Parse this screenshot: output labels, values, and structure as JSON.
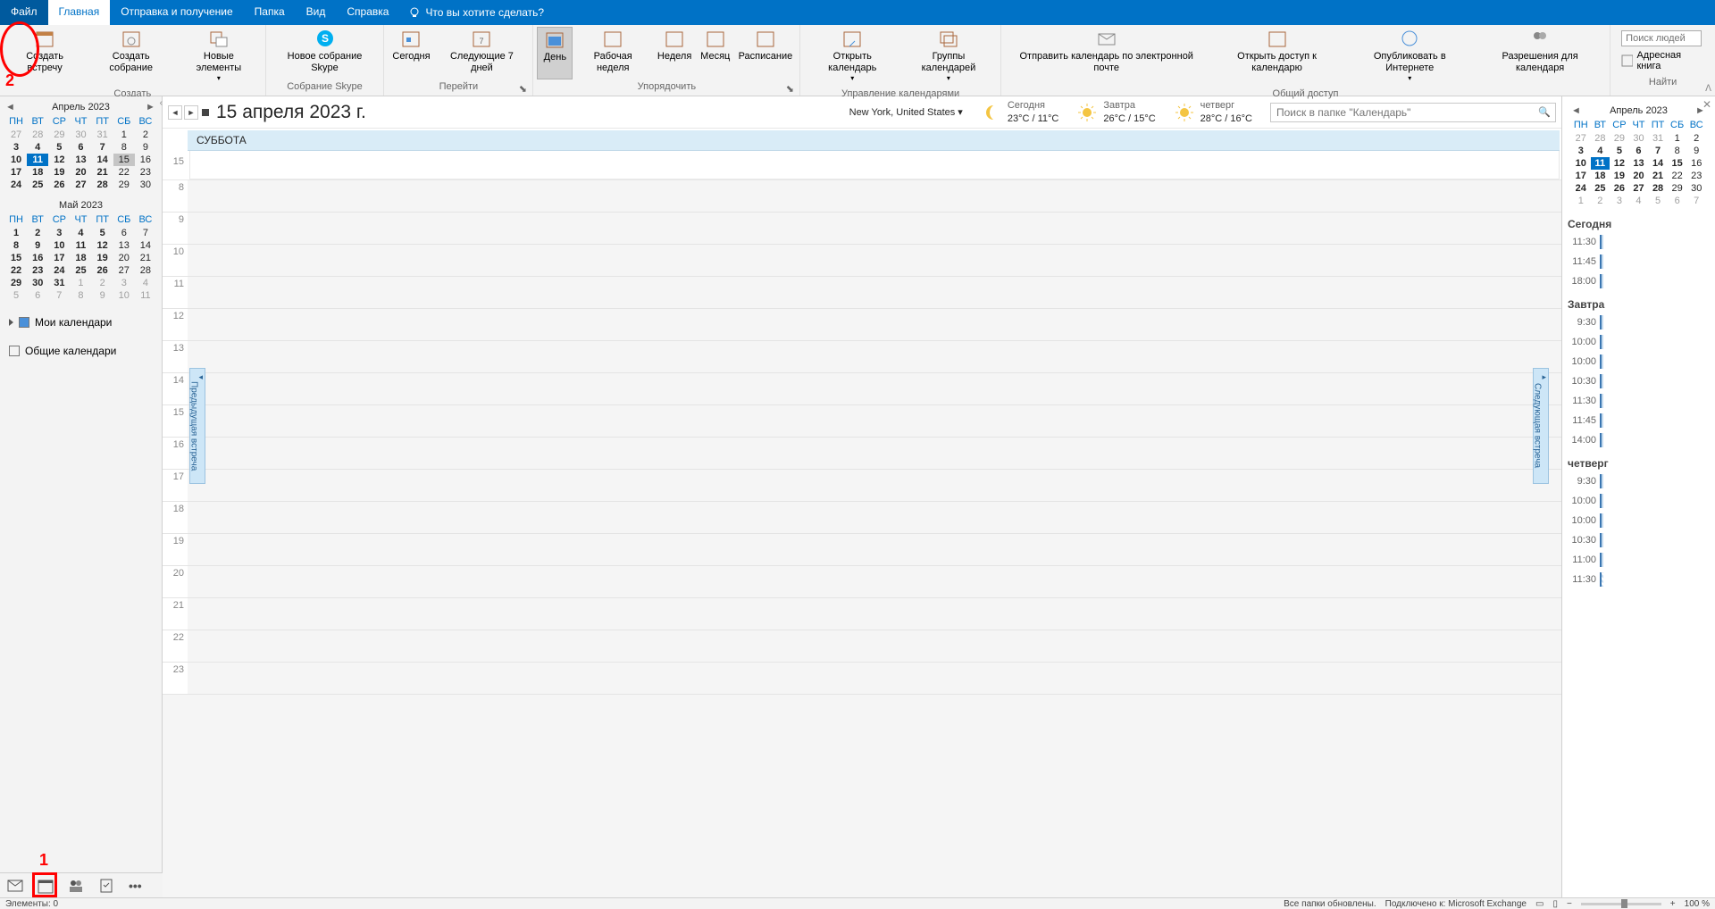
{
  "tabs": {
    "file": "Файл",
    "home": "Главная",
    "sendreceive": "Отправка и получение",
    "folder": "Папка",
    "view": "Вид",
    "help": "Справка",
    "tell_me": "Что вы хотите сделать?"
  },
  "ribbon": {
    "create": {
      "appt": "Создать встречу",
      "mtg": "Создать собрание",
      "items": "Новые элементы",
      "skype": "Новое собрание Skype",
      "label": "Создать",
      "skype_label": "Собрание Skype"
    },
    "goto": {
      "today": "Сегодня",
      "next7": "Следующие 7 дней",
      "label": "Перейти"
    },
    "arrange": {
      "day": "День",
      "work": "Рабочая неделя",
      "week": "Неделя",
      "month": "Месяц",
      "sched": "Расписание",
      "label": "Упорядочить"
    },
    "manage": {
      "open": "Открыть календарь",
      "groups": "Группы календарей",
      "label": "Управление календарями"
    },
    "share": {
      "email": "Отправить календарь по электронной почте",
      "access": "Открыть доступ к календарю",
      "publish": "Опубликовать в Интернете",
      "perms": "Разрешения для календаря",
      "label": "Общий доступ"
    },
    "find": {
      "ph": "Поиск людей",
      "addr": "Адресная книга",
      "label": "Найти"
    }
  },
  "date_nav": {
    "title": "15 апреля 2023 г.",
    "day_head": "СУББОТА",
    "allday_num": "15"
  },
  "weather": {
    "location": "New York, United States",
    "today": {
      "label": "Сегодня",
      "temp": "23°C / 11°C"
    },
    "tomorrow": {
      "label": "Завтра",
      "temp": "26°C / 15°C"
    },
    "thursday": {
      "label": "четверг",
      "temp": "28°C / 16°C"
    }
  },
  "search_ph": "Поиск в папке \"Календарь\"",
  "timeslots": [
    "8",
    "9",
    "10",
    "11",
    "12",
    "13",
    "14",
    "15",
    "16",
    "17",
    "18",
    "19",
    "20",
    "21",
    "22",
    "23"
  ],
  "prev_appt": "Предыдущая встреча",
  "next_appt": "Следующая встреча",
  "minical_left": {
    "month1": "Апрель 2023",
    "days": [
      "ПН",
      "ВТ",
      "СР",
      "ЧТ",
      "ПТ",
      "СБ",
      "ВС"
    ],
    "grid1": [
      {
        "d": "27",
        "o": 1
      },
      {
        "d": "28",
        "o": 1
      },
      {
        "d": "29",
        "o": 1
      },
      {
        "d": "30",
        "o": 1
      },
      {
        "d": "31",
        "o": 1
      },
      {
        "d": "1"
      },
      {
        "d": "2"
      },
      {
        "d": "3",
        "b": 1
      },
      {
        "d": "4",
        "b": 1
      },
      {
        "d": "5",
        "b": 1
      },
      {
        "d": "6",
        "b": 1
      },
      {
        "d": "7",
        "b": 1
      },
      {
        "d": "8"
      },
      {
        "d": "9"
      },
      {
        "d": "10",
        "b": 1
      },
      {
        "d": "11",
        "b": 1,
        "t": 1
      },
      {
        "d": "12",
        "b": 1
      },
      {
        "d": "13",
        "b": 1
      },
      {
        "d": "14",
        "b": 1
      },
      {
        "d": "15",
        "s": 1
      },
      {
        "d": "16"
      },
      {
        "d": "17",
        "b": 1
      },
      {
        "d": "18",
        "b": 1
      },
      {
        "d": "19",
        "b": 1
      },
      {
        "d": "20",
        "b": 1
      },
      {
        "d": "21",
        "b": 1
      },
      {
        "d": "22"
      },
      {
        "d": "23"
      },
      {
        "d": "24",
        "b": 1
      },
      {
        "d": "25",
        "b": 1
      },
      {
        "d": "26",
        "b": 1
      },
      {
        "d": "27",
        "b": 1
      },
      {
        "d": "28",
        "b": 1
      },
      {
        "d": "29"
      },
      {
        "d": "30"
      }
    ],
    "month2": "Май 2023",
    "grid2": [
      {
        "d": "1",
        "b": 1
      },
      {
        "d": "2",
        "b": 1
      },
      {
        "d": "3",
        "b": 1
      },
      {
        "d": "4",
        "b": 1
      },
      {
        "d": "5",
        "b": 1
      },
      {
        "d": "6"
      },
      {
        "d": "7"
      },
      {
        "d": "8",
        "b": 1
      },
      {
        "d": "9",
        "b": 1
      },
      {
        "d": "10",
        "b": 1
      },
      {
        "d": "11",
        "b": 1
      },
      {
        "d": "12",
        "b": 1
      },
      {
        "d": "13"
      },
      {
        "d": "14"
      },
      {
        "d": "15",
        "b": 1
      },
      {
        "d": "16",
        "b": 1
      },
      {
        "d": "17",
        "b": 1
      },
      {
        "d": "18",
        "b": 1
      },
      {
        "d": "19",
        "b": 1
      },
      {
        "d": "20"
      },
      {
        "d": "21"
      },
      {
        "d": "22",
        "b": 1
      },
      {
        "d": "23",
        "b": 1
      },
      {
        "d": "24",
        "b": 1
      },
      {
        "d": "25",
        "b": 1
      },
      {
        "d": "26",
        "b": 1
      },
      {
        "d": "27"
      },
      {
        "d": "28"
      },
      {
        "d": "29",
        "b": 1
      },
      {
        "d": "30",
        "b": 1
      },
      {
        "d": "31",
        "b": 1
      },
      {
        "d": "1",
        "o": 1
      },
      {
        "d": "2",
        "o": 1
      },
      {
        "d": "3",
        "o": 1
      },
      {
        "d": "4",
        "o": 1
      },
      {
        "d": "5",
        "o": 1
      },
      {
        "d": "6",
        "o": 1
      },
      {
        "d": "7",
        "o": 1
      },
      {
        "d": "8",
        "o": 1
      },
      {
        "d": "9",
        "o": 1
      },
      {
        "d": "10",
        "o": 1
      },
      {
        "d": "11",
        "o": 1
      }
    ],
    "my_calendars": "Мои календари",
    "shared_calendars": "Общие календари"
  },
  "minical_right": {
    "month": "Апрель 2023",
    "days": [
      "ПН",
      "ВТ",
      "СР",
      "ЧТ",
      "ПТ",
      "СБ",
      "ВС"
    ],
    "grid": [
      {
        "d": "27",
        "o": 1
      },
      {
        "d": "28",
        "o": 1
      },
      {
        "d": "29",
        "o": 1
      },
      {
        "d": "30",
        "o": 1
      },
      {
        "d": "31",
        "o": 1
      },
      {
        "d": "1"
      },
      {
        "d": "2"
      },
      {
        "d": "3",
        "b": 1
      },
      {
        "d": "4",
        "b": 1
      },
      {
        "d": "5",
        "b": 1
      },
      {
        "d": "6",
        "b": 1
      },
      {
        "d": "7",
        "b": 1
      },
      {
        "d": "8"
      },
      {
        "d": "9"
      },
      {
        "d": "10",
        "b": 1
      },
      {
        "d": "11",
        "b": 1,
        "t": 1
      },
      {
        "d": "12",
        "b": 1
      },
      {
        "d": "13",
        "b": 1
      },
      {
        "d": "14",
        "b": 1
      },
      {
        "d": "15",
        "b": 1
      },
      {
        "d": "16"
      },
      {
        "d": "17",
        "b": 1
      },
      {
        "d": "18",
        "b": 1
      },
      {
        "d": "19",
        "b": 1
      },
      {
        "d": "20",
        "b": 1
      },
      {
        "d": "21",
        "b": 1
      },
      {
        "d": "22"
      },
      {
        "d": "23"
      },
      {
        "d": "24",
        "b": 1
      },
      {
        "d": "25",
        "b": 1
      },
      {
        "d": "26",
        "b": 1
      },
      {
        "d": "27",
        "b": 1
      },
      {
        "d": "28",
        "b": 1
      },
      {
        "d": "29"
      },
      {
        "d": "30"
      },
      {
        "d": "1",
        "o": 1
      },
      {
        "d": "2",
        "o": 1
      },
      {
        "d": "3",
        "o": 1
      },
      {
        "d": "4",
        "o": 1
      },
      {
        "d": "5",
        "o": 1
      },
      {
        "d": "6",
        "o": 1
      },
      {
        "d": "7",
        "o": 1
      }
    ]
  },
  "agenda": {
    "today": {
      "head": "Сегодня",
      "items": [
        "11:30",
        "11:45",
        "18:00"
      ]
    },
    "tomorrow": {
      "head": "Завтра",
      "items": [
        "9:30",
        "10:00",
        "10:00",
        "10:30",
        "11:30",
        "11:45",
        "14:00"
      ]
    },
    "thursday": {
      "head": "четверг",
      "items": [
        "9:30",
        "10:00",
        "10:00",
        "10:30",
        "11:00",
        "11:30"
      ]
    }
  },
  "status": {
    "items": "Элементы: 0",
    "folders": "Все папки обновлены.",
    "conn": "Подключено к: Microsoft Exchange",
    "zoom": "100 %"
  },
  "annotations": {
    "num1": "1",
    "num2": "2"
  }
}
